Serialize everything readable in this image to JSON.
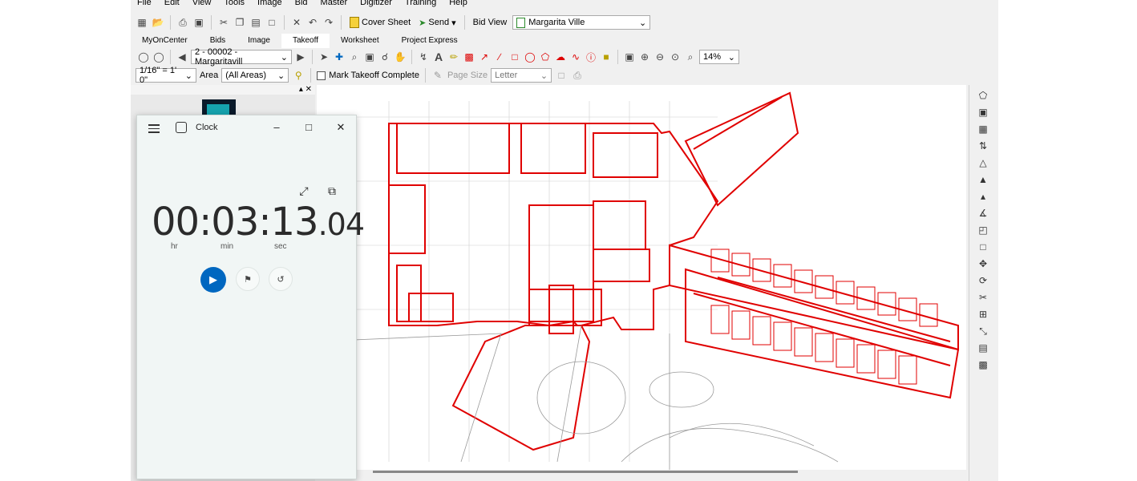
{
  "menu": [
    "File",
    "Edit",
    "View",
    "Tools",
    "Image",
    "Bid",
    "Master",
    "Digitizer",
    "Training",
    "Help"
  ],
  "toolbar1": {
    "cover_sheet": "Cover Sheet",
    "send": "Send",
    "bid_view_label": "Bid View",
    "bid_view_value": "Margarita Ville"
  },
  "tabs": [
    "MyOnCenter",
    "Bids",
    "Image",
    "Takeoff",
    "Worksheet",
    "Project Express"
  ],
  "toolbar2": {
    "page_combo": "2 - 00002 - Margaritavill",
    "zoom": "14%"
  },
  "toolbar3": {
    "scale": "1/16\" = 1' 0\"",
    "area_label": "Area",
    "area_value": "(All Areas)",
    "mark_complete": "Mark Takeoff Complete",
    "page_size_label": "Page Size",
    "page_size_value": "Letter"
  },
  "clock": {
    "app_name": "Clock",
    "hours": "00",
    "minutes": "03",
    "seconds": "13",
    "centiseconds": ".04",
    "unit_hr": "hr",
    "unit_min": "min",
    "unit_sec": "sec"
  },
  "colors": {
    "accent": "#0067c0",
    "takeoff_red": "#e00000",
    "clock_bg": "#f1f6f5"
  },
  "icons": [
    "menu-icon",
    "clock-app-icon",
    "minimize-icon",
    "maximize-icon",
    "close-icon",
    "expand-icon",
    "compact-overlay-icon",
    "play-icon",
    "flag-icon",
    "reset-icon"
  ]
}
